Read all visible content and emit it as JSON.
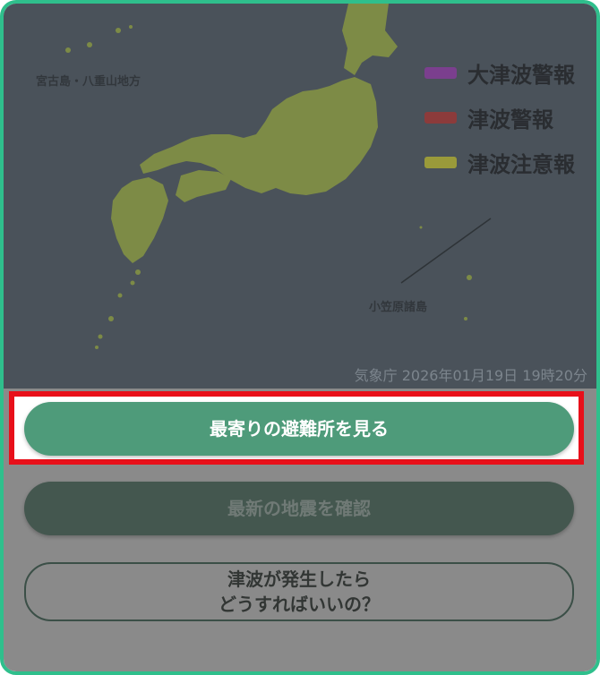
{
  "map": {
    "labels": {
      "miyako": "宮古島・八重山地方",
      "ogasawara": "小笠原諸島"
    },
    "legend": [
      {
        "label": "大津波警報",
        "color": "#7b3f8e"
      },
      {
        "label": "津波警報",
        "color": "#8c3b3b"
      },
      {
        "label": "津波注意報",
        "color": "#9a9a3a"
      }
    ],
    "agency_timestamp": "気象庁 2026年01月19日 19時20分",
    "colors": {
      "land": "#7d8b46",
      "sea": "#4a525a"
    }
  },
  "buttons": {
    "shelter": "最寄りの避難所を見る",
    "earthquake": "最新の地震を確認",
    "tsunami_help": "津波が発生したら\nどうすればいいの？"
  },
  "colors": {
    "frame_border": "#2fbf8c",
    "highlight_border": "#e8101a",
    "primary_button": "#4e9b7a"
  }
}
